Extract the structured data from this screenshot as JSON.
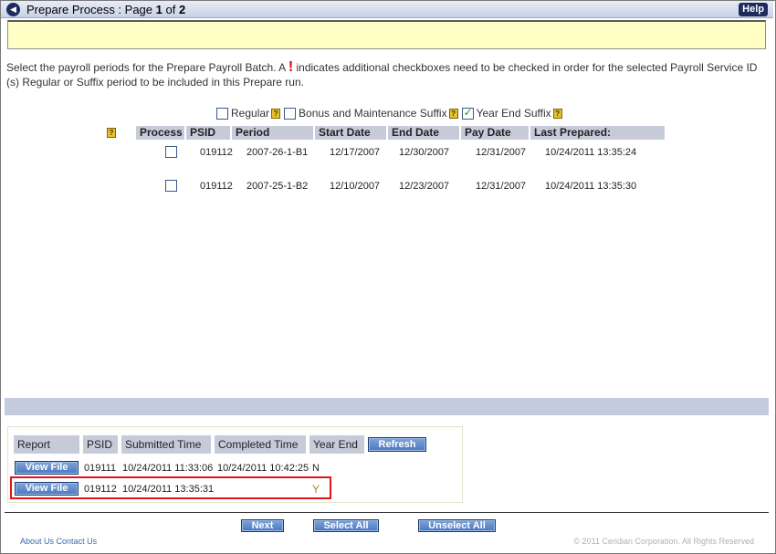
{
  "header": {
    "title_prefix": "Prepare Process  :  Page ",
    "page_current": "1",
    "of_label": " of ",
    "page_total": "2",
    "help_label": "Help"
  },
  "instructions": {
    "text_before": "Select the payroll periods for the Prepare Payroll Batch. A ",
    "mark": "!",
    "text_after": " indicates additional checkboxes need to be checked in order for the selected  Payroll Service ID (s) Regular or Suffix period to be included in this Prepare run."
  },
  "filters": [
    {
      "label": "Regular",
      "checked": false
    },
    {
      "label": "Bonus and Maintenance Suffix",
      "checked": false
    },
    {
      "label": "Year End Suffix",
      "checked": true
    }
  ],
  "help_glyph": "?",
  "period_table": {
    "headers": [
      "Process",
      "PSID",
      "Period",
      "Start Date",
      "End Date",
      "Pay Date",
      "Last Prepared:"
    ],
    "rows": [
      {
        "psid": "019112",
        "period": "2007-26-1-B1",
        "start": "12/17/2007",
        "end": "12/30/2007",
        "pay": "12/31/2007",
        "last": "10/24/2011 13:35:24",
        "checked": false
      },
      {
        "psid": "019112",
        "period": "2007-25-1-B2",
        "start": "12/10/2007",
        "end": "12/23/2007",
        "pay": "12/31/2007",
        "last": "10/24/2011 13:35:30",
        "checked": false
      }
    ]
  },
  "report_table": {
    "headers": [
      "Report",
      "PSID",
      "Submitted Time",
      "Completed Time",
      "Year End"
    ],
    "refresh_label": "Refresh",
    "rows": [
      {
        "button": "View File",
        "psid": "019111",
        "submitted": "10/24/2011 11:33:06",
        "completed": "10/24/2011 10:42:25",
        "year_end": "N"
      },
      {
        "button": "View File",
        "psid": "019112",
        "submitted": "10/24/2011 13:35:31",
        "completed": "",
        "year_end": "Y"
      }
    ]
  },
  "actions": {
    "next": "Next",
    "select_all": "Select All",
    "unselect_all": "Unselect All"
  },
  "footer": {
    "about": "About Us",
    "contact": "Contact Us",
    "copyright": "© 2011 Ceridian Corporation. All Rights Reserved"
  },
  "colors": {
    "message_bar": "#ffffc6",
    "header_cell": "#c7cbd9",
    "button": "#4a78c0",
    "highlight": "#e0151a"
  }
}
